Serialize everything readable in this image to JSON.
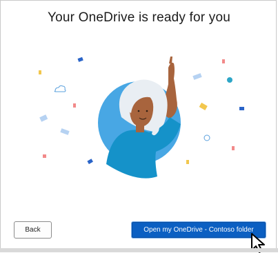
{
  "dialog": {
    "title": "Your OneDrive is ready for you"
  },
  "buttons": {
    "back_label": "Back",
    "open_label": "Open my OneDrive - Contoso folder"
  },
  "colors": {
    "accent": "#0b5fc2",
    "avatar_circle": "#48a7e4",
    "shirt": "#1592c9",
    "skin": "#a8643d",
    "hair": "#e9eef3"
  },
  "icons": [
    "cloud-icon",
    "confetti-icon",
    "mouse-pointer-icon"
  ]
}
